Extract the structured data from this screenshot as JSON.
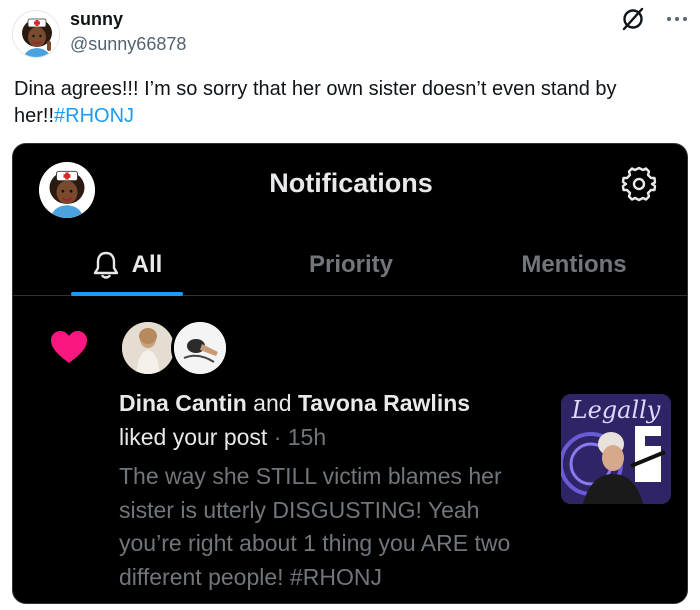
{
  "tweet": {
    "author_name": "sunny",
    "author_handle": "@sunny66878",
    "text": "Dina agrees!!! I’m so sorry that her own sister doesn’t even stand by her!!",
    "hashtag": "#RHONJ"
  },
  "screenshot": {
    "title": "Notifications",
    "tabs": [
      {
        "label": "All",
        "active": true
      },
      {
        "label": "Priority",
        "active": false
      },
      {
        "label": "Mentions",
        "active": false
      }
    ],
    "notification": {
      "user1": "Dina Cantin",
      "conjunction": "and",
      "user2": "Tavona Rawlins",
      "action": "liked your post",
      "separator": "·",
      "time": "15h",
      "snippet": "The way she STILL victim blames her sister is utterly DISGUSTING! Yeah you’re right about 1 thing you ARE two different people! #RHONJ",
      "thumbnail_text": "Legally"
    }
  },
  "colors": {
    "accent": "#1d9bf0",
    "heart": "#f91880",
    "dark_bg": "#000000",
    "muted": "#71767b"
  },
  "icons": [
    "grok-icon",
    "more-icon",
    "settings-icon",
    "bell-icon",
    "heart-icon"
  ]
}
